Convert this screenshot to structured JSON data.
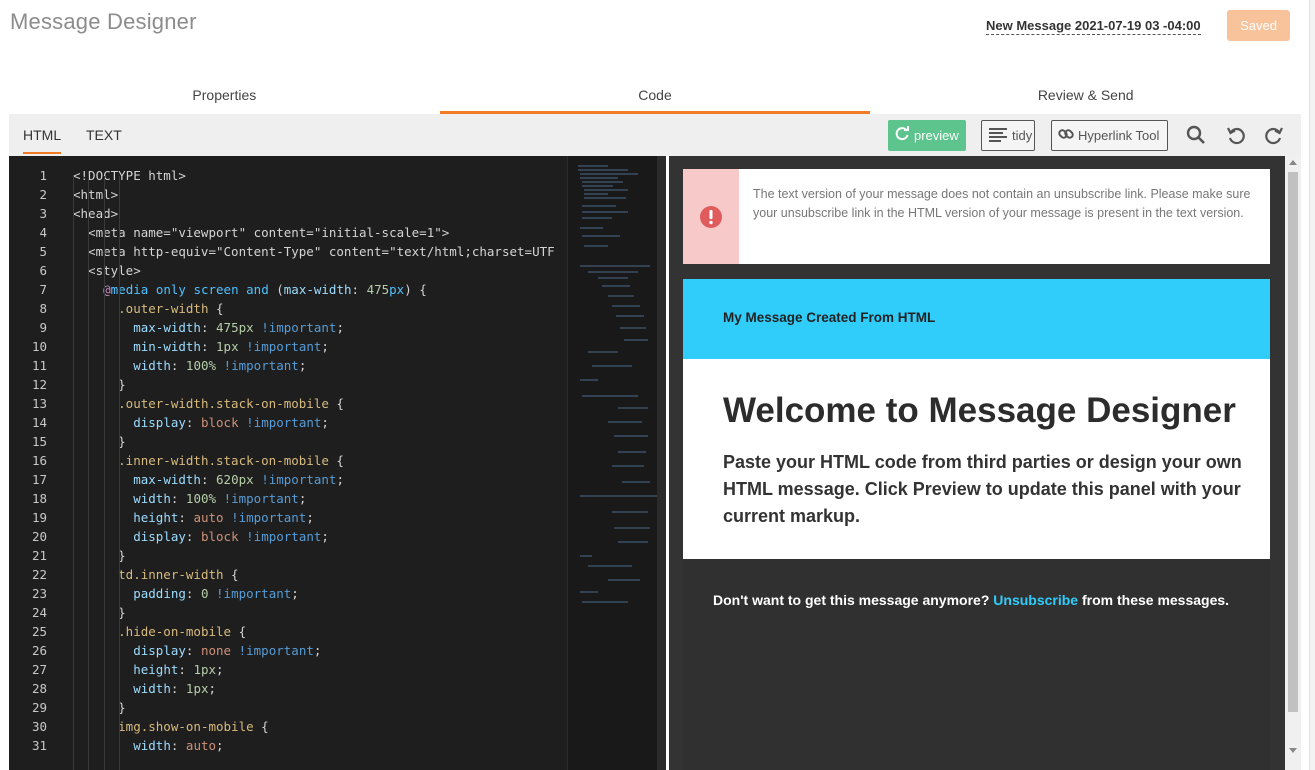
{
  "header": {
    "app_title": "Message Designer",
    "message_name": "New Message 2021-07-19 03 -04:00",
    "saved_label": "Saved"
  },
  "tabs": [
    {
      "label": "Properties",
      "active": false
    },
    {
      "label": "Code",
      "active": true
    },
    {
      "label": "Review & Send",
      "active": false
    }
  ],
  "toolbar": {
    "subtabs": [
      {
        "label": "HTML",
        "active": true
      },
      {
        "label": "TEXT",
        "active": false
      }
    ],
    "preview_label": "preview",
    "tidy_label": "tidy",
    "hyperlink_label": "Hyperlink Tool",
    "icons": [
      "search-icon",
      "undo-icon",
      "redo-icon"
    ]
  },
  "editor": {
    "lines": [
      "<!DOCTYPE html>",
      "<html>",
      "<head>",
      "  <meta name=\"viewport\" content=\"initial-scale=1\">",
      "  <meta http-equiv=\"Content-Type\" content=\"text/html;charset=UTF",
      "  <style>",
      "    @media only screen and (max-width: 475px) {",
      "      .outer-width {",
      "        max-width: 475px !important;",
      "        min-width: 1px !important;",
      "        width: 100% !important;",
      "      }",
      "      .outer-width.stack-on-mobile {",
      "        display: block !important;",
      "      }",
      "      .inner-width.stack-on-mobile {",
      "        max-width: 620px !important;",
      "        width: 100% !important;",
      "        height: auto !important;",
      "        display: block !important;",
      "      }",
      "      td.inner-width {",
      "        padding: 0 !important;",
      "      }",
      "      .hide-on-mobile {",
      "        display: none !important;",
      "        height: 1px;",
      "        width: 1px;",
      "      }",
      "      img.show-on-mobile {",
      "        width: auto;"
    ]
  },
  "preview": {
    "alert_text": "The text version of your message does not contain an unsubscribe link. Please make sure your unsubscribe link in the HTML version of your message is present in the text version.",
    "email_header": "My Message Created From HTML",
    "email_title": "Welcome to Message Designer",
    "email_body": "Paste your HTML code from third parties or design your own HTML message. Click Preview to update this panel with your current markup.",
    "footer_before": "Don't want to get this message anymore? ",
    "footer_link": "Unsubscribe",
    "footer_after": " from these messages."
  },
  "colors": {
    "accent": "#f07b24",
    "preview_button": "#5cc48c",
    "email_header_bg": "#30cdfa",
    "alert_bg": "#f7c9c9",
    "alert_icon": "#e05c5c",
    "editor_bg": "#1e1e1e"
  }
}
